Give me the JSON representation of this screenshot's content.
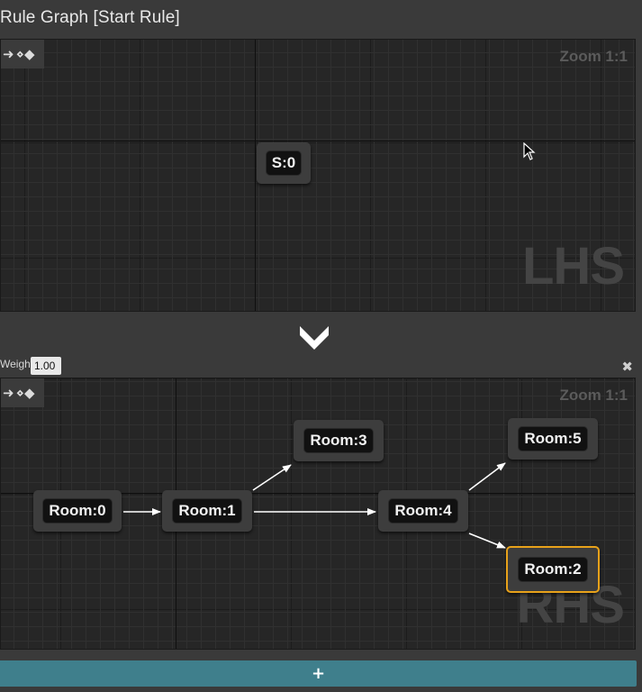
{
  "header": {
    "title": "Rule Graph [Start Rule]"
  },
  "lhs_panel": {
    "zoom_label": "Zoom 1:1",
    "watermark": "LHS",
    "nodes": [
      {
        "label": "S:0"
      }
    ]
  },
  "separator": {
    "icon": "chevron-down-icon"
  },
  "weight": {
    "label": "Weight:",
    "value": "1.00"
  },
  "rhs_panel": {
    "zoom_label": "Zoom 1:1",
    "watermark": "RHS",
    "nodes": [
      {
        "label": "Room:0"
      },
      {
        "label": "Room:1"
      },
      {
        "label": "Room:3"
      },
      {
        "label": "Room:4"
      },
      {
        "label": "Room:5"
      },
      {
        "label": "Room:2",
        "selected": true
      }
    ],
    "edges": [
      {
        "from": "Room:0",
        "to": "Room:1"
      },
      {
        "from": "Room:1",
        "to": "Room:3"
      },
      {
        "from": "Room:1",
        "to": "Room:4"
      },
      {
        "from": "Room:4",
        "to": "Room:5"
      },
      {
        "from": "Room:4",
        "to": "Room:2"
      }
    ]
  },
  "add_button": {
    "label": "+"
  },
  "colors": {
    "selection": "#e8a21a",
    "add_bar": "#3f7f8c"
  }
}
